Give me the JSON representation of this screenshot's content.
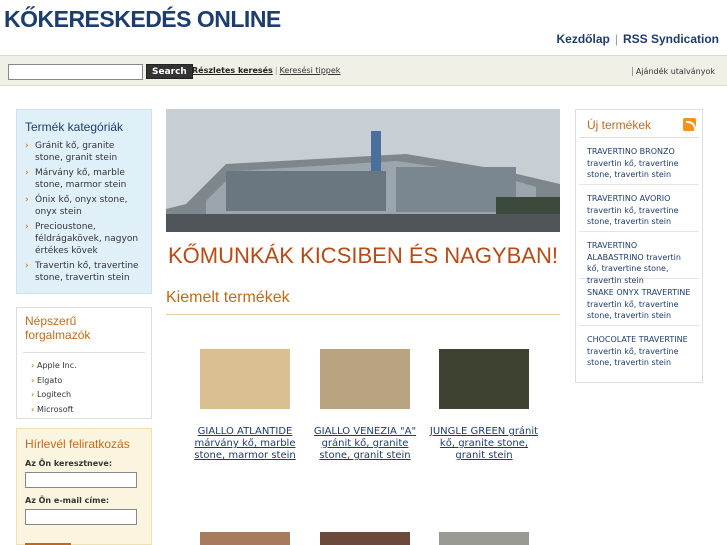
{
  "header": {
    "title": "KŐKERESKEDÉS ONLINE",
    "nav": [
      "Kezdőlap",
      "RSS Syndication"
    ]
  },
  "search": {
    "placeholder": "",
    "button": "Search",
    "advanced": "Részletes keresés",
    "tips": "Keresési tippek",
    "gift": "Ajándék utalványok"
  },
  "categories": {
    "title": "Termék kategóriák",
    "items": [
      "Gránit kő, granite stone, granit stein",
      "Márvány kő, marble stone, marmor stein",
      "Ónix kő, onyx stone, onyx stein",
      "Precioustone, féldrágakövek, nagyon értékes kövek",
      "Travertin kő, travertine stone, travertin stein"
    ]
  },
  "brands": {
    "title": "Népszerű forgalmazók",
    "items": [
      "Apple Inc.",
      "Elgato",
      "Logitech",
      "Microsoft"
    ]
  },
  "newsletter": {
    "title": "Hírlevél feliratkozás",
    "first_name_label": "Az Ön keresztneve:",
    "email_label": "Az Ön e-mail címe:"
  },
  "main": {
    "slogan": "KŐMUNKÁK KICSIBEN ÉS NAGYBAN!",
    "featured_title": "Kiemelt termékek",
    "products": [
      {
        "name": "GIALLO ATLANTIDE márvány kő, marble stone, marmor stein",
        "color": "#d9bf92"
      },
      {
        "name": "GIALLO VENEZIA \"A\" gránit kő, granite stone, granit stein",
        "color": "#b9a381"
      },
      {
        "name": "JUNGLE GREEN gránit kő, granite stone, granit stein",
        "color": "#3d4330"
      }
    ]
  },
  "new_products": {
    "title": "Új termékek",
    "items": [
      "TRAVERTINO BRONZO travertin kő, travertine stone, travertin stein",
      "TRAVERTINO AVORIO travertin kő, travertine stone, travertin stein",
      "TRAVERTINO ALABASTRINO travertin kő, travertine stone, travertin stein",
      "SNAKE ONYX TRAVERTINE travertin kő, travertine stone, travertin stein",
      "CHOCOLATE TRAVERTINE travertin kő, travertine stone, travertin stein"
    ]
  },
  "colors": {
    "brand_blue": "#1c3d6e",
    "accent_orange": "#c36a1a",
    "slogan_red": "#b84a14"
  }
}
